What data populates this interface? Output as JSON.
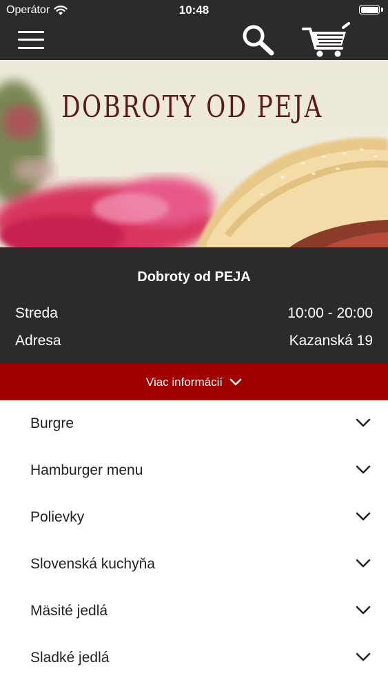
{
  "status_bar": {
    "carrier": "Operátor",
    "time": "10:48"
  },
  "nav_bar": {
    "icons": [
      "menu-icon",
      "search-icon",
      "cart-icon"
    ]
  },
  "hero": {
    "title": "DOBROTY OD PEJA"
  },
  "restaurant": {
    "name": "Dobroty od PEJA",
    "hours_label": "Streda",
    "hours_value": "10:00 - 20:00",
    "address_label": "Adresa",
    "address_value": "Kazanská 19"
  },
  "more_info": {
    "label": "Viac informácií"
  },
  "categories": [
    {
      "label": "Burgre"
    },
    {
      "label": "Hamburger menu"
    },
    {
      "label": "Polievky"
    },
    {
      "label": "Slovenská kuchyňa"
    },
    {
      "label": "Mäsité jedlá"
    },
    {
      "label": "Sladké jedlá"
    }
  ],
  "colors": {
    "header_bg": "#2b2b2b",
    "accent_red": "#a10000",
    "title_brown": "#5a1b1b"
  }
}
